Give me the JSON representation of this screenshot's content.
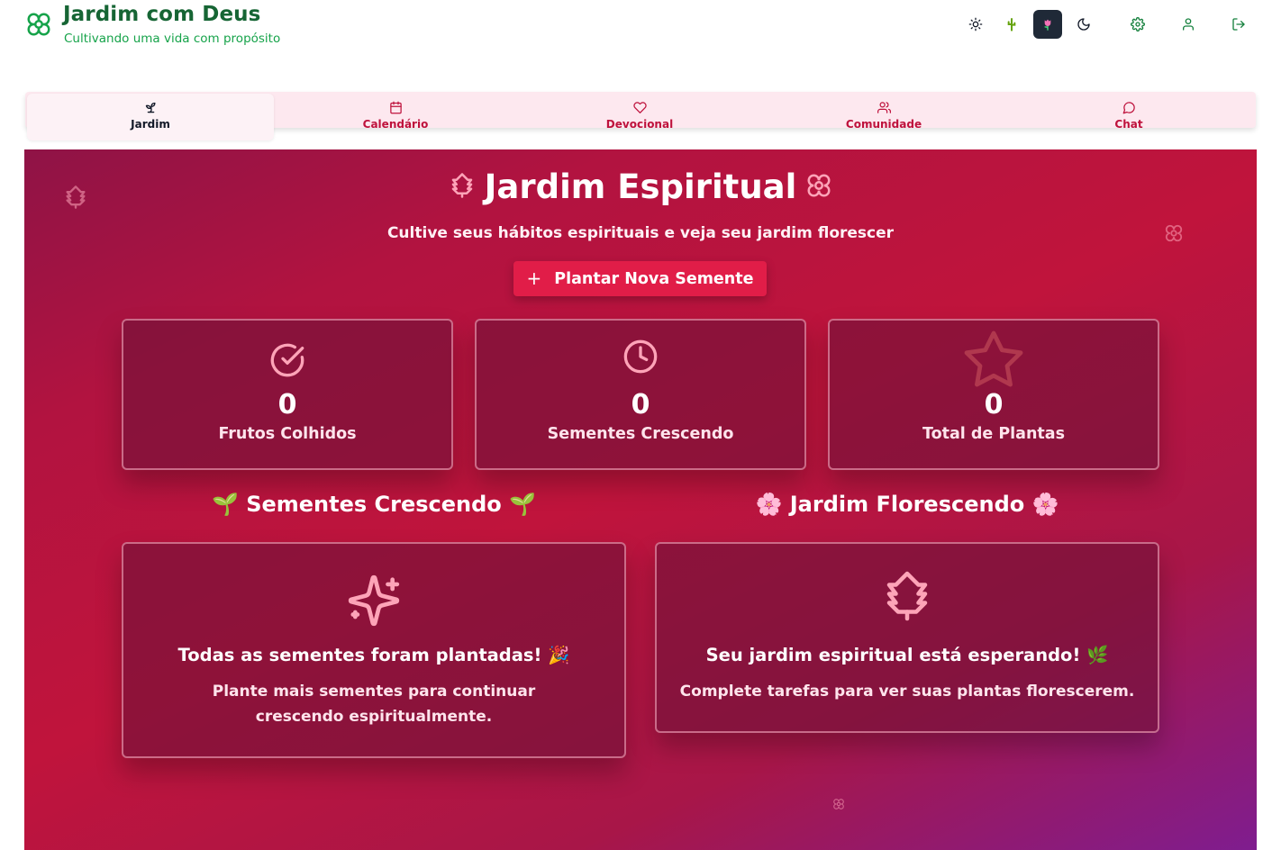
{
  "header": {
    "title": "Jardim com Deus",
    "subtitle": "Cultivando uma vida com propósito",
    "actions": [
      {
        "name": "theme-light-button",
        "icon": "sun-icon"
      },
      {
        "name": "theme-cactus-button",
        "icon": "cactus-icon",
        "emoji": "🌵"
      },
      {
        "name": "theme-tulip-button",
        "icon": "tulip-icon",
        "emoji": "🌷",
        "active": true
      },
      {
        "name": "theme-dark-button",
        "icon": "moon-icon"
      },
      {
        "name": "settings-button",
        "icon": "gear-icon"
      },
      {
        "name": "profile-button",
        "icon": "user-icon"
      },
      {
        "name": "logout-button",
        "icon": "logout-icon"
      }
    ]
  },
  "nav": {
    "items": [
      {
        "label": "Jardim",
        "icon": "sprout-icon",
        "active": true
      },
      {
        "label": "Calendário",
        "icon": "calendar-icon"
      },
      {
        "label": "Devocional",
        "icon": "heart-icon"
      },
      {
        "label": "Comunidade",
        "icon": "users-icon"
      },
      {
        "label": "Chat",
        "icon": "chat-bubble-icon"
      }
    ]
  },
  "hero": {
    "title": "Jardim Espiritual",
    "subtitle": "Cultive seus hábitos espirituais e veja seu jardim florescer",
    "button_label": "Plantar Nova Semente",
    "button_icon": "plus-icon"
  },
  "stats": [
    {
      "value": "0",
      "label": "Frutos Colhidos",
      "icon": "check-circle-icon"
    },
    {
      "value": "0",
      "label": "Sementes Crescendo",
      "icon": "clock-icon"
    },
    {
      "value": "0",
      "label": "Total de Plantas",
      "icon": "star-icon"
    }
  ],
  "sections": {
    "growing": {
      "title": "🌱 Sementes Crescendo 🌱",
      "empty_title": "Todas as sementes foram plantadas! 🎉",
      "empty_text": "Plante mais sementes para continuar crescendo espiritualmente.",
      "icon": "sparkles-icon"
    },
    "blooming": {
      "title": "🌸 Jardim Florescendo 🌸",
      "empty_title": "Seu jardim espiritual está esperando! 🌿",
      "empty_text": "Complete tarefas para ver suas plantas florescerem.",
      "icon": "tree-icon"
    }
  },
  "colors": {
    "brand_green": "#166534",
    "accent_rose": "#e11d48",
    "nav_bg": "#fde8ef",
    "icon_pink": "#fda4b8"
  }
}
